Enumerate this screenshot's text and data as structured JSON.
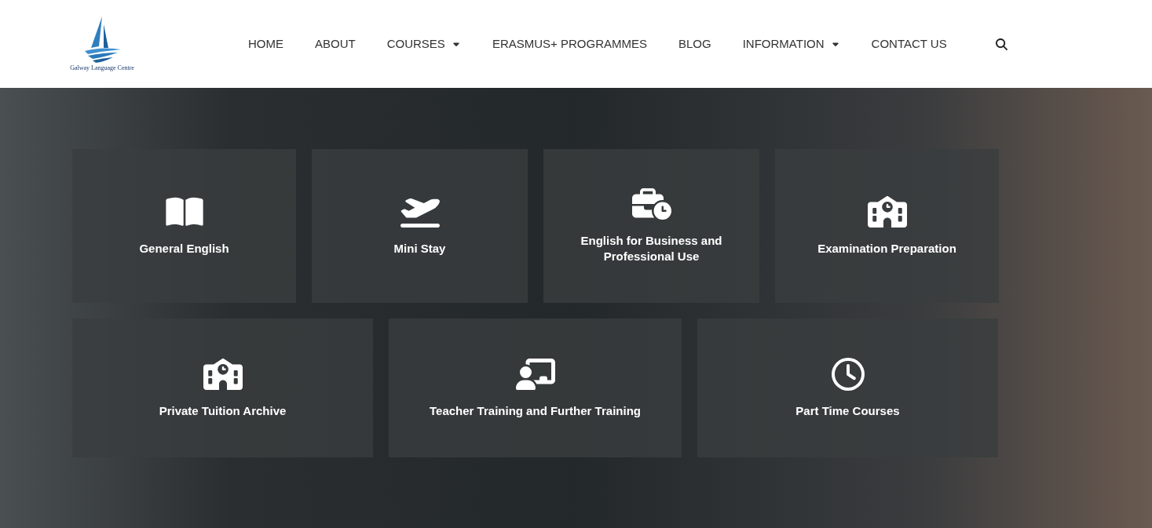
{
  "logo": {
    "text": "Galway Language Centre"
  },
  "nav": [
    {
      "label": "HOME",
      "dropdown": false
    },
    {
      "label": "ABOUT",
      "dropdown": false
    },
    {
      "label": "COURSES",
      "dropdown": true
    },
    {
      "label": "ERASMUS+ PROGRAMMES",
      "dropdown": false
    },
    {
      "label": "BLOG",
      "dropdown": false
    },
    {
      "label": "INFORMATION",
      "dropdown": true
    },
    {
      "label": "CONTACT US",
      "dropdown": false
    }
  ],
  "course_rows": [
    [
      {
        "title": "General English",
        "kind": "book"
      },
      {
        "title": "Mini Stay",
        "kind": "plane"
      },
      {
        "title": "English for Business and Professional Use",
        "kind": "briefcase"
      },
      {
        "title": "Examination Preparation",
        "kind": "school"
      }
    ],
    [
      {
        "title": "Private Tuition Archive",
        "kind": "school"
      },
      {
        "title": "Teacher Training and Further Training",
        "kind": "teacher"
      },
      {
        "title": "Part Time Courses",
        "kind": "clock"
      }
    ]
  ]
}
